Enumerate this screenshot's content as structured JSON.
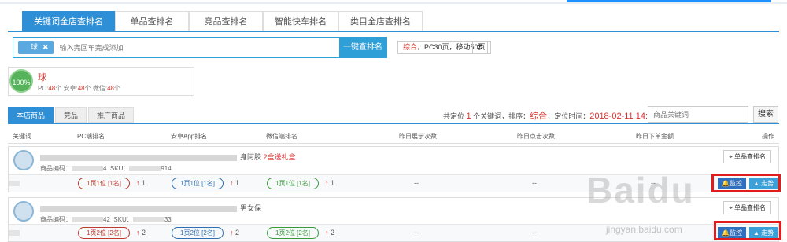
{
  "tabs": [
    "关键词全店查排名",
    "单品查排名",
    "竞品查排名",
    "智能快车排名",
    "类目全店查排名"
  ],
  "search": {
    "chip_suffix": "球",
    "chip_close": "✖",
    "placeholder": "输入完回车完成添加",
    "button": "一键查排名"
  },
  "config": {
    "text_prefix": "综合",
    "text_rest": "，PC30页，移动50页",
    "gear_icon": "⚙"
  },
  "summary": {
    "percent": "100%",
    "name": "球",
    "pc_label": "PC:",
    "pc_val": "48",
    "android_label": "个 安卓:",
    "android_val": "48",
    "wechat_label": "个 微信:",
    "wechat_val": "48",
    "unit": "个"
  },
  "lower_tabs": [
    "本店商品",
    "竞品",
    "推广商品"
  ],
  "locate": {
    "prefix": "共定位",
    "count": "1",
    "mid": "个关键词，排序：",
    "sort": "综合",
    "time_label": "，定位时间：",
    "time": "2018-02-11 14:05:26"
  },
  "kw_search": {
    "placeholder": "商品关键词",
    "button": "搜索"
  },
  "columns": [
    "关键词",
    "PC端排名",
    "安卓App排名",
    "微信端排名",
    "昨日展示次数",
    "昨日点击次数",
    "昨日下单金额",
    "操作"
  ],
  "rows": [
    {
      "name_suffix": "身阿胶",
      "gift": "2盒送礼盒",
      "code_label": "商品编码：",
      "code_tail": "4",
      "sku_label": "SKU：",
      "sku_tail": "914",
      "rank_button": "单品查排名",
      "pc": "1页1位 [1名]",
      "pc_change": "1",
      "android": "1页1位 [1名]",
      "android_change": "1",
      "wechat": "1页1位 [1名]",
      "wechat_change": "1",
      "shows": "--",
      "clicks": "--",
      "orders": "--",
      "monitor": "监控",
      "trend": "走势"
    },
    {
      "name_suffix": "男女保",
      "gift": "",
      "code_label": "商品编码：",
      "code_tail": "42",
      "sku_label": "SKU：",
      "sku_tail": "33",
      "rank_button": "单品查排名",
      "pc": "1页2位 [2名]",
      "pc_change": "2",
      "android": "1页2位 [2名]",
      "android_change": "2",
      "wechat": "1页2位 [2名]",
      "wechat_change": "2",
      "shows": "--",
      "clicks": "--",
      "orders": "--",
      "monitor": "监控",
      "trend": "走势"
    }
  ],
  "icons": {
    "up_arrow": "↑",
    "bell_icon": "🔔",
    "chart_icon": "▲",
    "marker_icon": "⌖"
  },
  "watermark": {
    "brand": "Baidu",
    "url": "jingyan.baidu.com"
  }
}
